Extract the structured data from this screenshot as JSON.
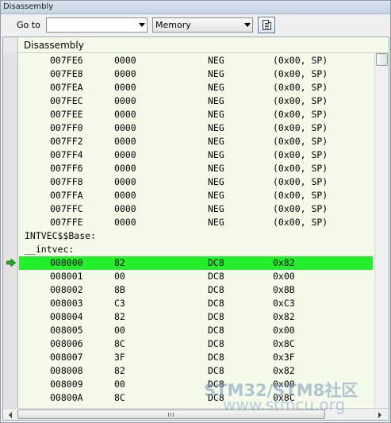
{
  "window": {
    "title": "Disassembly"
  },
  "toolbar": {
    "goto_label": "Go to",
    "goto_value": "",
    "memory_select": "Memory",
    "doc_button_icon": "document-icon"
  },
  "pane": {
    "header": "Disassembly"
  },
  "rows": [
    {
      "addr": "007FE6",
      "code": "0000",
      "mn": "NEG",
      "op": "(0x00, SP)"
    },
    {
      "addr": "007FE8",
      "code": "0000",
      "mn": "NEG",
      "op": "(0x00, SP)"
    },
    {
      "addr": "007FEA",
      "code": "0000",
      "mn": "NEG",
      "op": "(0x00, SP)"
    },
    {
      "addr": "007FEC",
      "code": "0000",
      "mn": "NEG",
      "op": "(0x00, SP)"
    },
    {
      "addr": "007FEE",
      "code": "0000",
      "mn": "NEG",
      "op": "(0x00, SP)"
    },
    {
      "addr": "007FF0",
      "code": "0000",
      "mn": "NEG",
      "op": "(0x00, SP)"
    },
    {
      "addr": "007FF2",
      "code": "0000",
      "mn": "NEG",
      "op": "(0x00, SP)"
    },
    {
      "addr": "007FF4",
      "code": "0000",
      "mn": "NEG",
      "op": "(0x00, SP)"
    },
    {
      "addr": "007FF6",
      "code": "0000",
      "mn": "NEG",
      "op": "(0x00, SP)"
    },
    {
      "addr": "007FF8",
      "code": "0000",
      "mn": "NEG",
      "op": "(0x00, SP)"
    },
    {
      "addr": "007FFA",
      "code": "0000",
      "mn": "NEG",
      "op": "(0x00, SP)"
    },
    {
      "addr": "007FFC",
      "code": "0000",
      "mn": "NEG",
      "op": "(0x00, SP)"
    },
    {
      "addr": "007FFE",
      "code": "0000",
      "mn": "NEG",
      "op": "(0x00, SP)"
    },
    {
      "label": "INTVEC$$Base:"
    },
    {
      "label": "__intvec:"
    },
    {
      "addr": "008000",
      "code": "82",
      "mn": "DC8",
      "op": "0x82",
      "current": true
    },
    {
      "addr": "008001",
      "code": "00",
      "mn": "DC8",
      "op": "0x00"
    },
    {
      "addr": "008002",
      "code": "8B",
      "mn": "DC8",
      "op": "0x8B"
    },
    {
      "addr": "008003",
      "code": "C3",
      "mn": "DC8",
      "op": "0xC3"
    },
    {
      "addr": "008004",
      "code": "82",
      "mn": "DC8",
      "op": "0x82"
    },
    {
      "addr": "008005",
      "code": "00",
      "mn": "DC8",
      "op": "0x00"
    },
    {
      "addr": "008006",
      "code": "8C",
      "mn": "DC8",
      "op": "0x8C"
    },
    {
      "addr": "008007",
      "code": "3F",
      "mn": "DC8",
      "op": "0x3F"
    },
    {
      "addr": "008008",
      "code": "82",
      "mn": "DC8",
      "op": "0x82"
    },
    {
      "addr": "008009",
      "code": "00",
      "mn": "DC8",
      "op": "0x00"
    },
    {
      "addr": "00800A",
      "code": "8C",
      "mn": "DC8",
      "op": "0x8C"
    }
  ],
  "colors": {
    "current_row": "#23ee2a",
    "arrow": "#1db81f",
    "pane_bg": "#f4fbea"
  },
  "watermark": {
    "line1": "STM32/STM8社区",
    "line2": "www.stmcu.org"
  }
}
